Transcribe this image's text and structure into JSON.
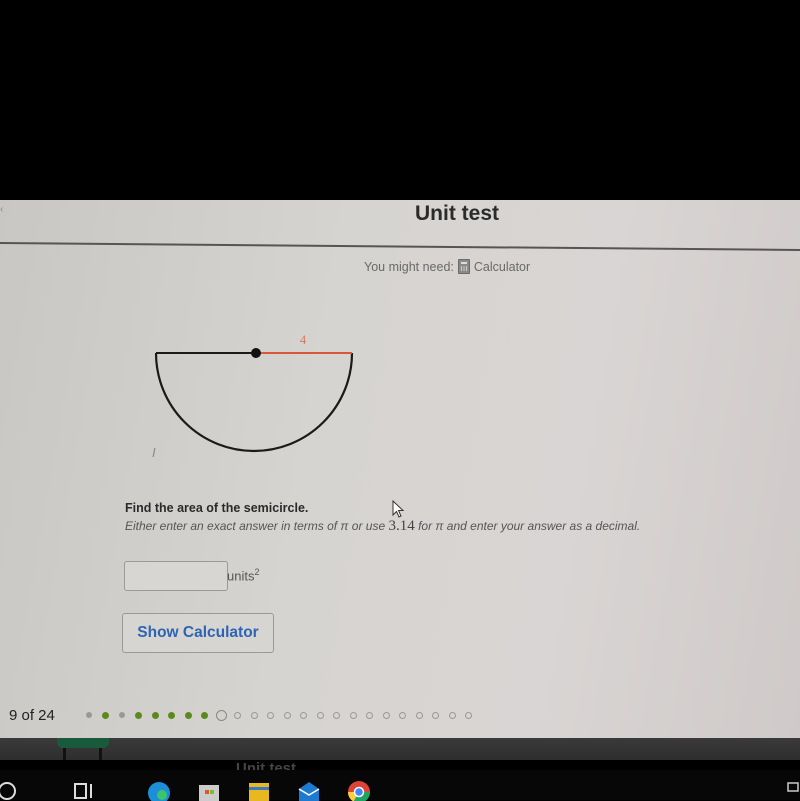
{
  "header": {
    "title": "Unit test",
    "might_need_label": "You might need:",
    "calculator_link": "Calculator"
  },
  "figure": {
    "shape": "semicircle",
    "radius_label": "4",
    "colors": {
      "outline": "#1a1a1a",
      "radius": "#d9563a",
      "center_dot": "#111111"
    }
  },
  "question": {
    "prompt": "Find the area of the semicircle.",
    "instructions_before": "Either enter an exact answer in terms of π or use ",
    "pi_value": "3.14",
    "instructions_after": " for π and enter your answer as a decimal."
  },
  "answer": {
    "value": "",
    "placeholder": "",
    "units_label": "units",
    "units_exponent": "2"
  },
  "buttons": {
    "show_calculator": "Show Calculator"
  },
  "progress": {
    "label": "9 of 24",
    "current": 9,
    "total": 24,
    "states": [
      "gray",
      "green",
      "gray",
      "green",
      "green",
      "green",
      "green",
      "green",
      "current",
      "todo",
      "todo",
      "todo",
      "todo",
      "todo",
      "todo",
      "todo",
      "todo",
      "todo",
      "todo",
      "todo",
      "todo",
      "todo",
      "todo",
      "todo"
    ],
    "colors": {
      "green": "#5b8a1c",
      "gray": "#999999"
    }
  },
  "background_window": {
    "title": "Unit test"
  },
  "taskbar": {
    "icons": [
      "search-icon",
      "task-view-icon",
      "edge-icon",
      "store-icon",
      "file-explorer-icon",
      "mail-icon",
      "chrome-icon"
    ]
  }
}
